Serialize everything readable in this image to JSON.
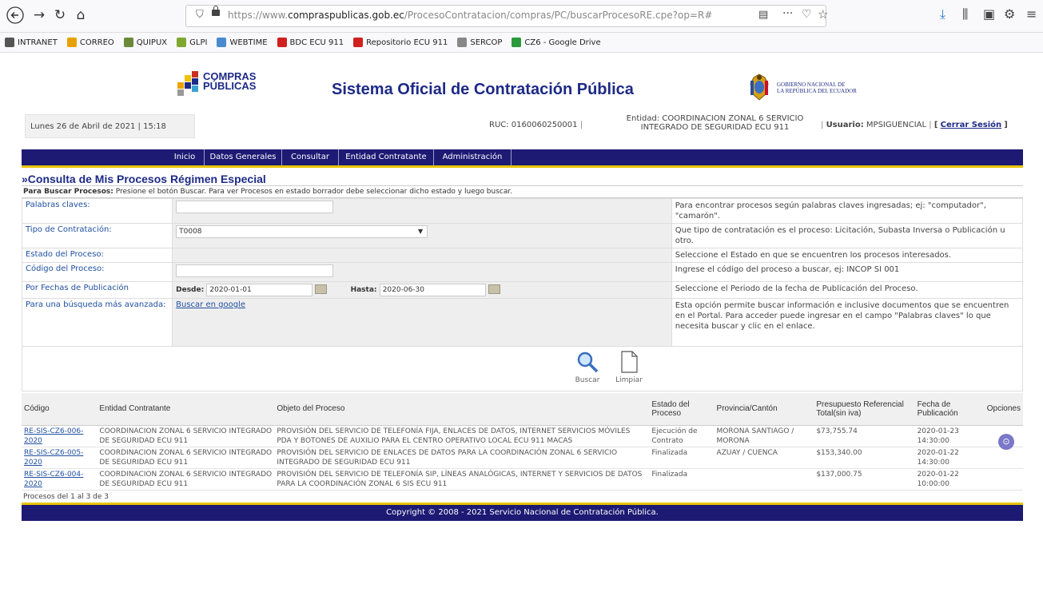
{
  "browser": {
    "url_prefix": "https://www.",
    "url_domain": "compraspublicas.gob.ec",
    "url_path": "/ProcesoContratacion/compras/PC/buscarProcesoRE.cpe?op=R#",
    "bookmarks": [
      {
        "label": "INTRANET",
        "icon_color": "#555555"
      },
      {
        "label": "CORREO",
        "icon_color": "#e6a000"
      },
      {
        "label": "QUIPUX",
        "icon_color": "#6a8a3a"
      },
      {
        "label": "GLPI",
        "icon_color": "#7fa830"
      },
      {
        "label": "WEBTIME",
        "icon_color": "#4a8ad0"
      },
      {
        "label": "BDC ECU 911",
        "icon_color": "#d02020"
      },
      {
        "label": "Repositorio ECU 911",
        "icon_color": "#d02020"
      },
      {
        "label": "SERCOP",
        "icon_color": "#888888"
      },
      {
        "label": "CZ6 - Google Drive",
        "icon_color": "#2a9a3a"
      }
    ]
  },
  "header": {
    "logo_line1": "COMPRAS",
    "logo_line2": "PÚBLICAS",
    "title": "Sistema Oficial de Contratación Pública",
    "gov_line1": "GOBIERNO NACIONAL DE",
    "gov_line2": "LA REPÚBLICA DEL ECUADOR"
  },
  "info": {
    "date": "Lunes 26 de Abril de 2021 | 15:18",
    "ruc": "RUC: 0160060250001",
    "entidad_line1": "Entidad: COORDINACION ZONAL 6 SERVICIO",
    "entidad_line2": "INTEGRADO DE SEGURIDAD ECU 911",
    "usuario_label": "Usuario:",
    "usuario_value": "MPSIGUENCIAL",
    "logout": "Cerrar Sesión"
  },
  "menu": [
    "Inicio",
    "Datos Generales",
    "Consultar",
    "Entidad Contratante",
    "Administración"
  ],
  "search": {
    "title": "»Consulta de Mis Procesos Régimen Especial",
    "instr_bold": "Para Buscar Procesos:",
    "instr_text": " Presione el botón Buscar. Para ver Procesos en estado borrador debe seleccionar dicho estado y luego buscar.",
    "fields": {
      "palabras_label": "Palabras claves:",
      "palabras_help": "Para encontrar procesos según palabras claves ingresadas; ej: \"computador\", \"camarón\".",
      "tipo_label": "Tipo de Contratación:",
      "tipo_value": "T0008",
      "tipo_help": "Que tipo de contratación es el proceso: Licitación, Subasta Inversa o Publicación u otro.",
      "estado_label": "Estado del Proceso:",
      "estado_help": "Seleccione el Estado en que se encuentren los procesos interesados.",
      "codigo_label": "Código del Proceso:",
      "codigo_help": "Ingrese el código del proceso a buscar, ej: INCOP SI 001",
      "fechas_label": "Por Fechas de Publicación",
      "desde_label": "Desde:",
      "desde_value": "2020-01-01",
      "hasta_label": "Hasta:",
      "hasta_value": "2020-06-30",
      "fechas_help": "Seleccione el Periodo de la fecha de Publicación del Proceso.",
      "avanzada_label": "Para una búsqueda más avanzada:",
      "avanzada_link": "Buscar en google",
      "avanzada_help": "Esta opción permite buscar información e inclusive documentos que se encuentren en el Portal. Para acceder puede ingresar en el campo \"Palabras claves\" lo que necesita buscar y clic en el enlace."
    },
    "buscar": "Buscar",
    "limpiar": "Limpiar"
  },
  "results": {
    "headers": [
      "Código",
      "Entidad Contratante",
      "Objeto del Proceso",
      "Estado del Proceso",
      "Provincia/Cantón",
      "Presupuesto Referencial Total(sin iva)",
      "Fecha de Publicación",
      "Opciones"
    ],
    "rows": [
      {
        "codigo": "RE-SIS-CZ6-006-2020",
        "entidad": "COORDINACION ZONAL 6 SERVICIO INTEGRADO DE SEGURIDAD ECU 911",
        "objeto": "PROVISIÓN DEL SERVICIO DE TELEFONÍA FIJA, ENLACES DE DATOS, INTERNET SERVICIOS MÓVILES PDA Y BOTONES DE AUXILIO PARA EL CENTRO OPERATIVO LOCAL ECU 911 MACAS",
        "estado": "Ejecución de Contrato",
        "provincia": "MORONA SANTIAGO / MORONA",
        "presupuesto": "$73,755.74",
        "fecha": "2020-01-23 14:30:00"
      },
      {
        "codigo": "RE-SIS-CZ6-005-2020",
        "entidad": "COORDINACION ZONAL 6 SERVICIO INTEGRADO DE SEGURIDAD ECU 911",
        "objeto": "PROVISIÓN DEL SERVICIO DE ENLACES DE DATOS PARA LA COORDINACIÓN ZONAL 6 SERVICIO INTEGRADO DE SEGURIDAD ECU 911",
        "estado": "Finalizada",
        "provincia": "AZUAY / CUENCA",
        "presupuesto": "$153,340.00",
        "fecha": "2020-01-22 14:30:00"
      },
      {
        "codigo": "RE-SIS-CZ6-004-2020",
        "entidad": "COORDINACION ZONAL 6 SERVICIO INTEGRADO DE SEGURIDAD ECU 911",
        "objeto": "PROVISIÓN DEL SERVICIO DE TELEFONÍA SIP, LÍNEAS ANALÓGICAS, INTERNET Y SERVICIOS DE DATOS PARA LA COORDINACIÓN ZONAL 6 SIS ECU 911",
        "estado": "Finalizada",
        "provincia": "",
        "presupuesto": "$137,000.75",
        "fecha": "2020-01-22 10:00:00"
      }
    ],
    "count": "Procesos del 1 al 3 de 3"
  },
  "footer": "Copyright © 2008 - 2021 Servicio Nacional de Contratación Pública."
}
